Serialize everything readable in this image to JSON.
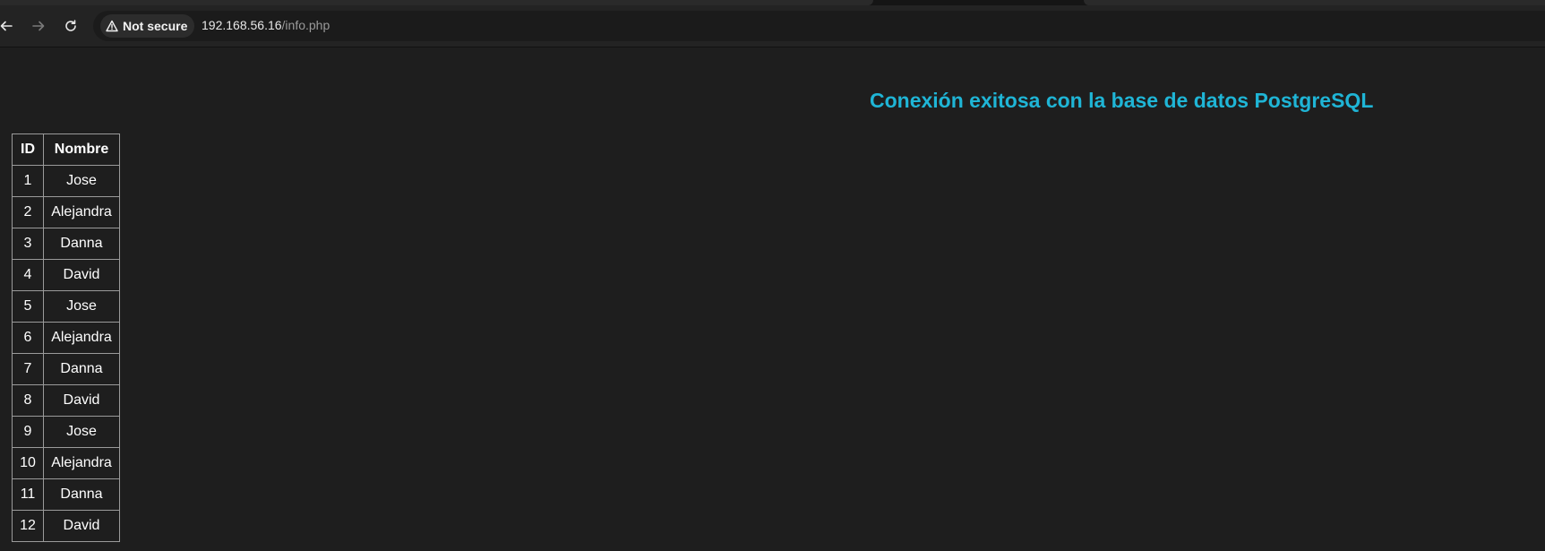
{
  "browser": {
    "security_label": "Not secure",
    "url_host": "192.168.56.16",
    "url_path": "/info.php"
  },
  "page": {
    "heading": "Conexión exitosa con la base de datos PostgreSQL",
    "heading_color": "#1fb5d6",
    "table": {
      "headers": [
        "ID",
        "Nombre"
      ],
      "rows": [
        [
          "1",
          "Jose"
        ],
        [
          "2",
          "Alejandra"
        ],
        [
          "3",
          "Danna"
        ],
        [
          "4",
          "David"
        ],
        [
          "5",
          "Jose"
        ],
        [
          "6",
          "Alejandra"
        ],
        [
          "7",
          "Danna"
        ],
        [
          "8",
          "David"
        ],
        [
          "9",
          "Jose"
        ],
        [
          "10",
          "Alejandra"
        ],
        [
          "11",
          "Danna"
        ],
        [
          "12",
          "David"
        ]
      ]
    }
  }
}
